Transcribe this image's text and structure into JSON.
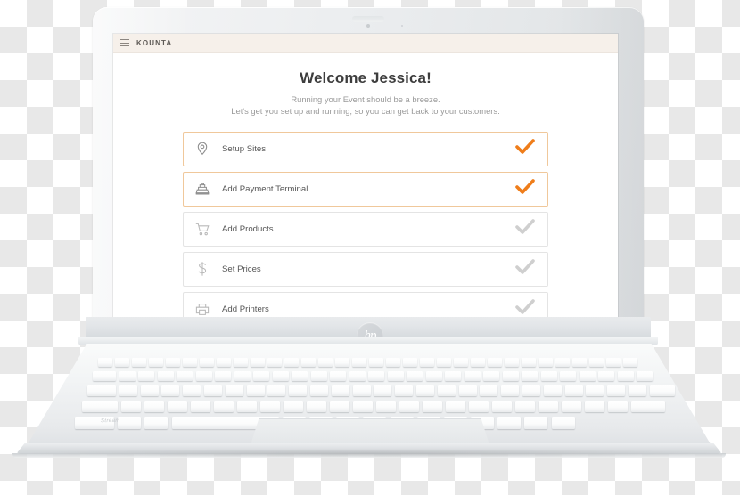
{
  "device": {
    "brand_logo": "hp",
    "model_mark": "Stream",
    "webcam": "webcam-icon"
  },
  "app": {
    "menu_icon": "hamburger-menu-icon",
    "brand": "KOUNTA"
  },
  "main": {
    "title": "Welcome Jessica!",
    "subtitle_line1": "Running your Event should be a breeze.",
    "subtitle_line2": "Let's get you set up and running, so you can get back to your customers."
  },
  "checklist": {
    "items": [
      {
        "label": "Setup Sites",
        "icon": "location-pin-icon",
        "state": "done",
        "check_icon": "check-icon"
      },
      {
        "label": "Add Payment Terminal",
        "icon": "cash-register-icon",
        "state": "done",
        "check_icon": "check-icon"
      },
      {
        "label": "Add Products",
        "icon": "shopping-cart-icon",
        "state": "pending",
        "check_icon": "check-icon"
      },
      {
        "label": "Set Prices",
        "icon": "dollar-sign-icon",
        "state": "pending",
        "check_icon": "check-icon"
      },
      {
        "label": "Add Printers",
        "icon": "printer-icon",
        "state": "pending",
        "check_icon": "check-icon"
      }
    ]
  },
  "colors": {
    "accent_orange": "#ef7d1a",
    "done_border": "#f0c89b",
    "pending_border": "#e4e4e4",
    "pending_check": "#cfcfcf",
    "appbar_bg": "#f6f0ea",
    "title_text": "#3d3d3d",
    "body_text": "#9a9a9a"
  }
}
